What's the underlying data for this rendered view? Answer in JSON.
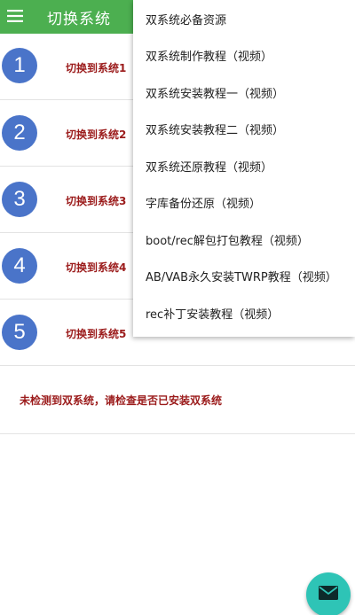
{
  "appbar": {
    "title": "切换系统",
    "menu_icon": "hamburger-menu-icon",
    "color": "#4caf50"
  },
  "systems": [
    {
      "number": "1",
      "label": "切换到系统1"
    },
    {
      "number": "2",
      "label": "切换到系统2"
    },
    {
      "number": "3",
      "label": "切换到系统3"
    },
    {
      "number": "4",
      "label": "切换到系统4"
    },
    {
      "number": "5",
      "label": "切换到系统5"
    }
  ],
  "status_message": "未检测到双系统，请检查是否已安装双系统",
  "dropdown_menu": {
    "items": [
      {
        "label": "双系统必备资源"
      },
      {
        "label": "双系统制作教程（视频）"
      },
      {
        "label": "双系统安装教程一（视频）"
      },
      {
        "label": "双系统安装教程二（视频）"
      },
      {
        "label": "双系统还原教程（视频）"
      },
      {
        "label": "字库备份还原（视频）"
      },
      {
        "label": "boot/rec解包打包教程（视频）"
      },
      {
        "label": "AB/VAB永久安装TWRP教程（视频）"
      },
      {
        "label": "rec补丁安装教程（视频）"
      }
    ]
  },
  "fab": {
    "icon": "envelope-icon",
    "color": "#2ec4b6"
  },
  "colors": {
    "circle": "#4a74c9",
    "label_text": "#9b1b1b"
  }
}
